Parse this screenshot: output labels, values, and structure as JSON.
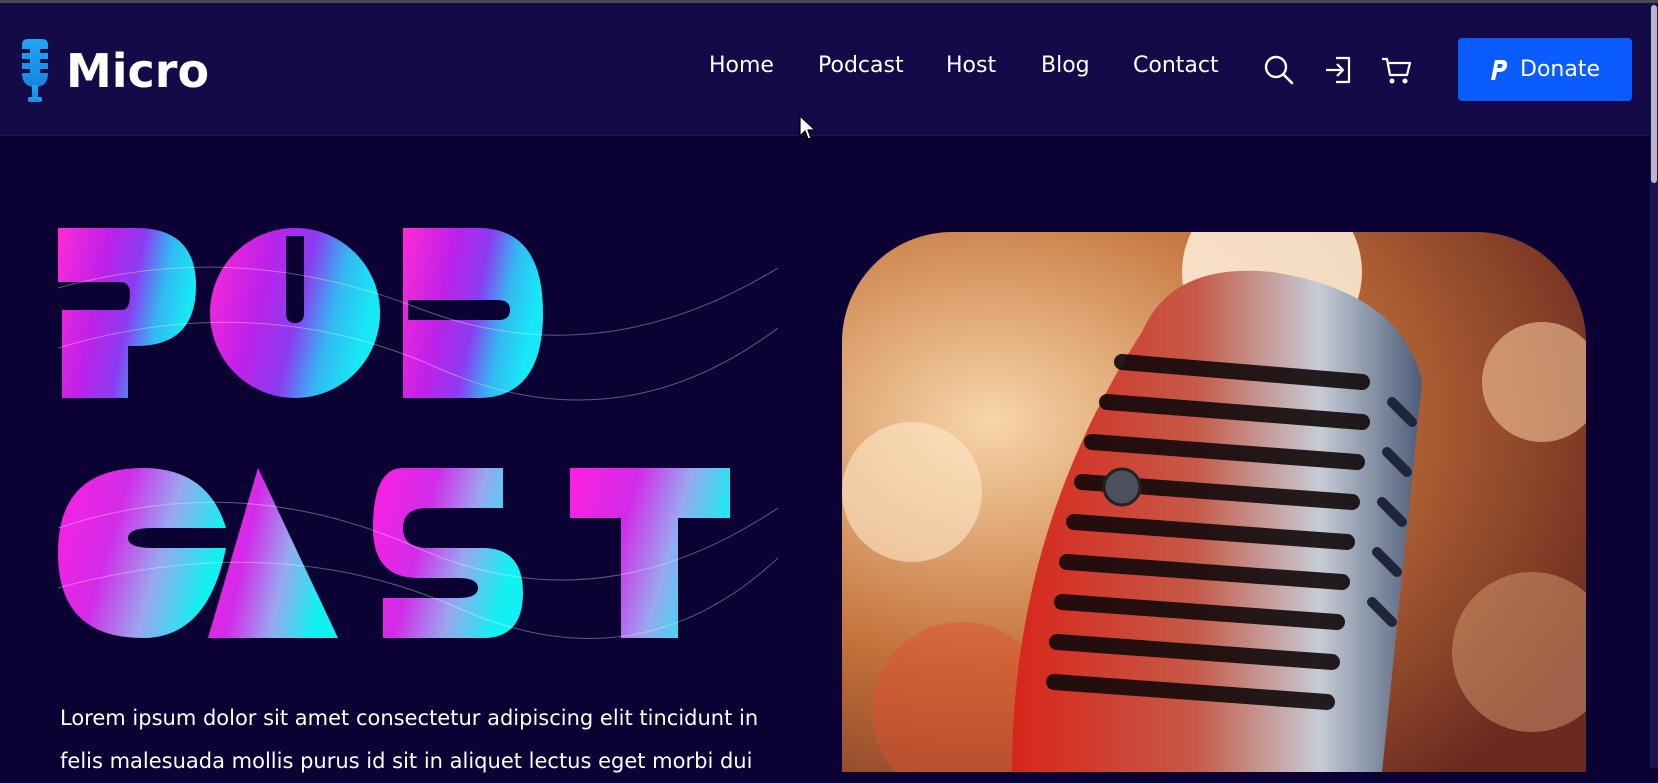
{
  "logo": {
    "text": "Micro",
    "icon": "microphone-icon"
  },
  "nav": {
    "items": [
      {
        "label": "Home"
      },
      {
        "label": "Podcast"
      },
      {
        "label": "Host"
      },
      {
        "label": "Blog"
      },
      {
        "label": "Contact"
      }
    ],
    "icons": [
      "search-icon",
      "login-icon",
      "cart-icon"
    ]
  },
  "donate": {
    "label": "Donate",
    "icon": "paypal-icon"
  },
  "hero": {
    "title_line1": "POD",
    "title_line2": "CAST",
    "paragraph": "Lorem ipsum dolor sit amet consectetur adipiscing elit tincidunt in felis malesuada mollis purus id sit in aliquet lectus eget morbi dui",
    "image": "vintage-microphone-photo"
  },
  "colors": {
    "background": "#0b0233",
    "header": "#130a47",
    "accent": "#0b5cff",
    "gradient_pink": "#ff2bd6",
    "gradient_purple": "#a12ef0",
    "gradient_cyan": "#16e8f5",
    "logo_icon": "#1ea6f5"
  }
}
